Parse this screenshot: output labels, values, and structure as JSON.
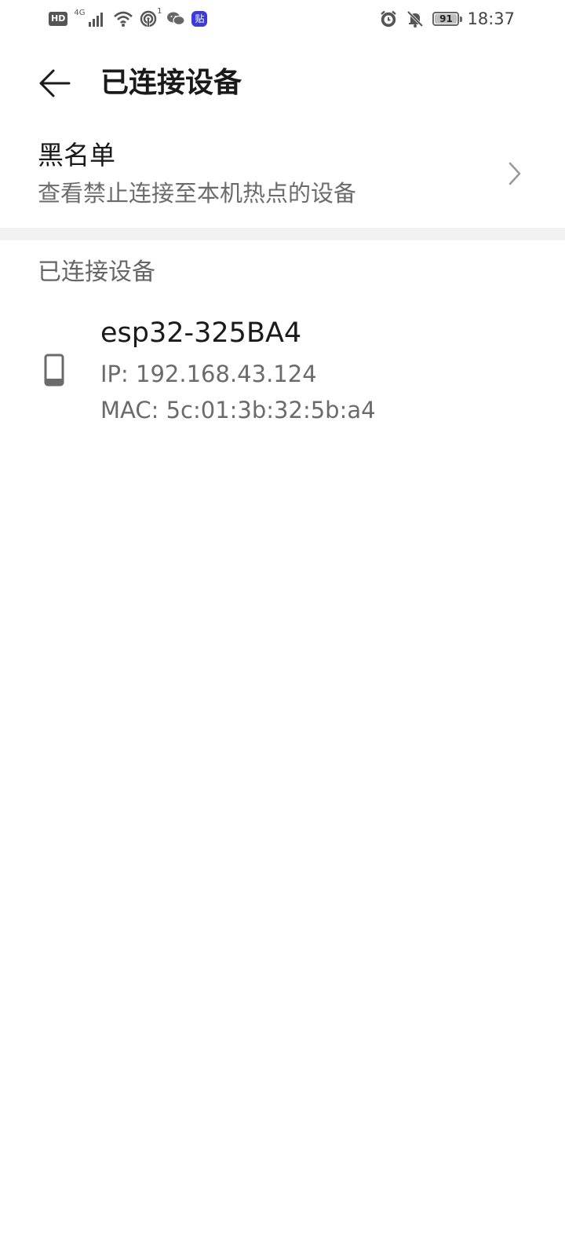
{
  "status_bar": {
    "left_icons": [
      "hd-icon",
      "4g-signal-icon",
      "wifi-icon",
      "hotspot-icon",
      "wechat-icon",
      "tieba-icon"
    ],
    "hd_label": "HD",
    "network_label": "4G",
    "hotspot_count": "1",
    "tieba_label": "贴",
    "right_icons": [
      "alarm-icon",
      "mute-bell-icon",
      "battery-icon"
    ],
    "battery_level": "91",
    "time": "18:37"
  },
  "header": {
    "title": "已连接设备",
    "back_icon": "arrow-left-icon"
  },
  "blacklist": {
    "title": "黑名单",
    "subtitle": "查看禁止连接至本机热点的设备",
    "chevron_icon": "chevron-right-icon"
  },
  "connected_section": {
    "header": "已连接设备",
    "devices": [
      {
        "name": "esp32-325BA4",
        "ip": "IP: 192.168.43.124",
        "mac": "MAC: 5c:01:3b:32:5b:a4",
        "icon": "phone-icon"
      }
    ]
  },
  "colors": {
    "background": "#ffffff",
    "primary_text": "#1a1a1a",
    "secondary_text": "#6b6b6b",
    "divider": "#f2f2f2",
    "tieba_badge": "#3b3bd6"
  }
}
